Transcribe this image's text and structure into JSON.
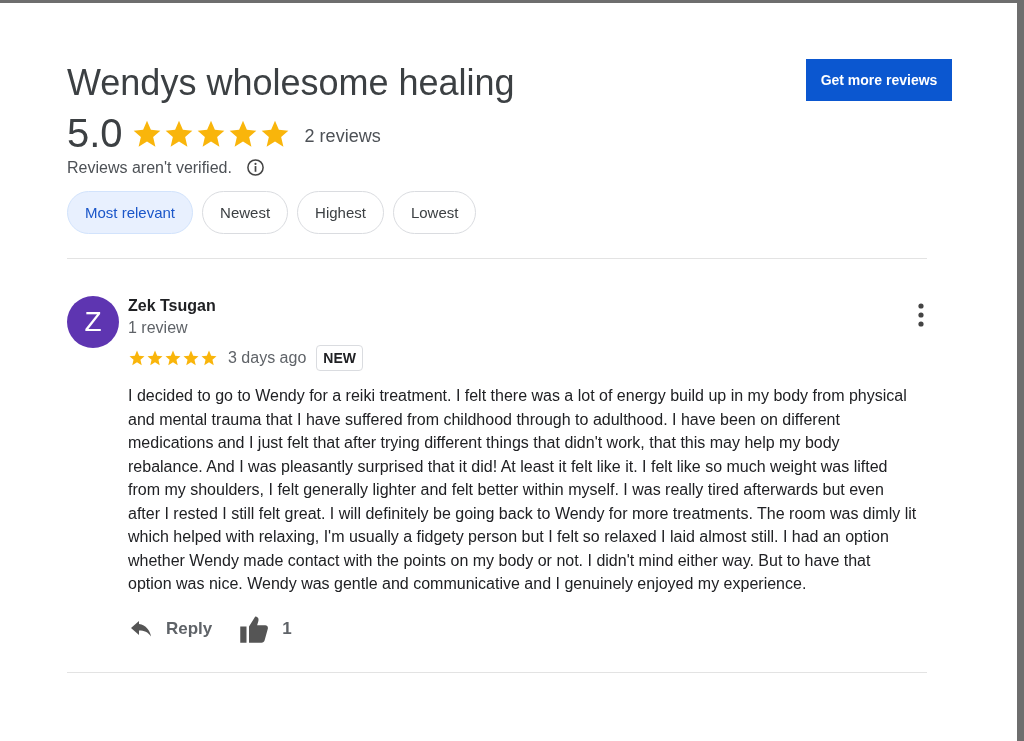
{
  "title": "Wendys wholesome healing",
  "action_button": "Get more reviews",
  "rating": {
    "score": "5.0",
    "stars": 5,
    "count": "2 reviews"
  },
  "verification_note": "Reviews aren't verified.",
  "sort_chips": [
    {
      "label": "Most relevant",
      "selected": true
    },
    {
      "label": "Newest",
      "selected": false
    },
    {
      "label": "Highest",
      "selected": false
    },
    {
      "label": "Lowest",
      "selected": false
    }
  ],
  "reviews": [
    {
      "avatar_letter": "Z",
      "name": "Zek Tsugan",
      "review_count": "1 review",
      "stars": 5,
      "time": "3 days ago",
      "badge": "NEW",
      "text": "I decided to go to Wendy for a reiki treatment. I felt there was a lot of energy build up in my body from physical and mental trauma that I have suffered from childhood through to adulthood. I have been on different medications and I just felt that after trying different things that didn't work, that this may help my body rebalance. And I was pleasantly surprised that it did! At least it felt like it. I felt like so much weight was lifted from my shoulders, I felt generally lighter and felt better within myself. I was really tired afterwards but even after I rested I still felt great. I will definitely be going back to Wendy for more treatments. The room was dimly lit which helped with relaxing, I'm usually a fidgety person but I felt so relaxed I laid almost still. I had an option whether Wendy made contact with the points on my body or not. I didn't mind either way. But to have that option was nice. Wendy was gentle and communicative and I genuinely enjoyed my experience.",
      "reply_label": "Reply",
      "like_count": "1"
    }
  ]
}
